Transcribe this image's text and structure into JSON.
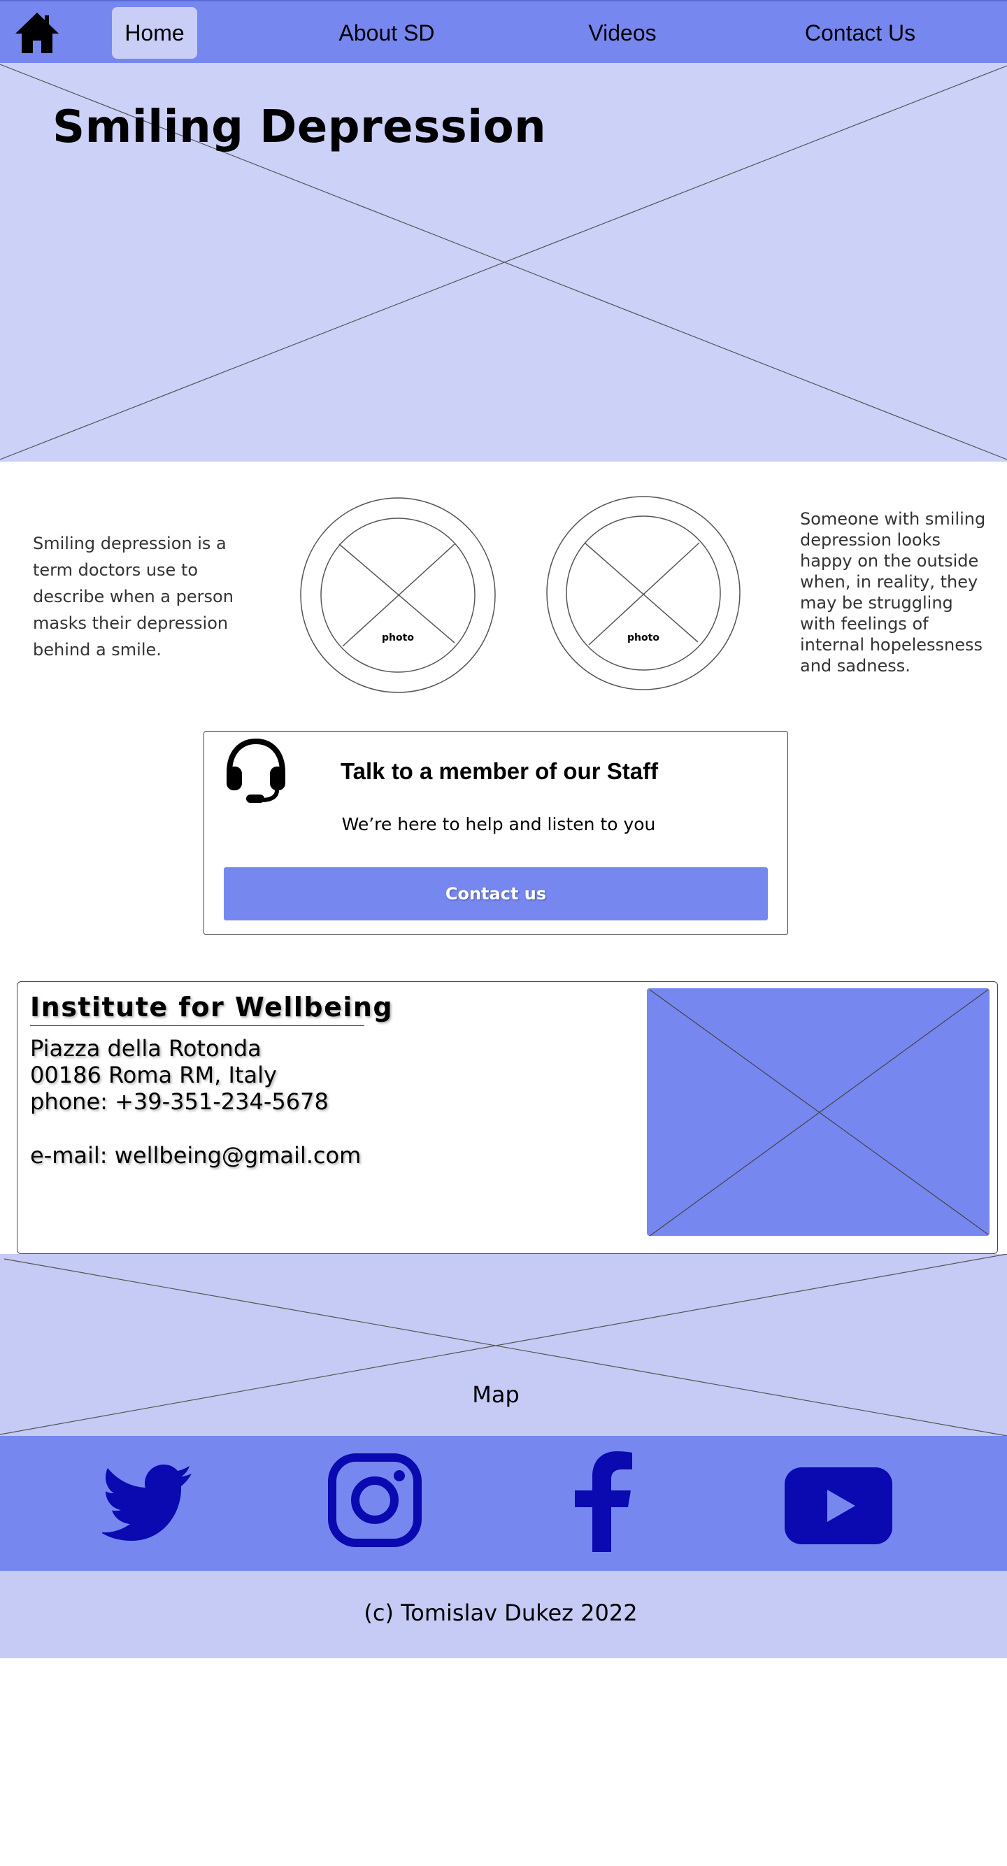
{
  "nav": {
    "items": [
      {
        "label": "Home"
      },
      {
        "label": "About SD"
      },
      {
        "label": "Videos"
      },
      {
        "label": "Contact Us"
      }
    ]
  },
  "hero": {
    "title": "Smiling Depression"
  },
  "info": {
    "left_text": "Smiling depression is a term doctors use to describe when a person masks their depression behind a smile.",
    "right_text": "Someone with smiling depression looks happy on the outside when, in reality, they may be struggling with feelings of internal hopelessness and sadness.",
    "photo_label": "photo"
  },
  "staff": {
    "title": "Talk to a member of our Staff",
    "subtitle": "We’re here to help and listen to you",
    "button_label": "Contact us"
  },
  "institute": {
    "title": "Institute for Wellbeing",
    "address_line_1": "Piazza della Rotonda",
    "address_line_2": "00186 Roma RM, Italy",
    "phone": "phone: +39-351-234-5678",
    "email": "e-mail: wellbeing@gmail.com"
  },
  "map": {
    "label": "Map"
  },
  "social": {
    "icons": [
      "twitter-icon",
      "instagram-icon",
      "facebook-icon",
      "youtube-icon"
    ]
  },
  "footer": {
    "copyright": "(c) Tomislav Dukez 2022"
  },
  "colors": {
    "nav_bg": "#7787f0",
    "hero_bg": "#cbd1f7",
    "section_bg": "#c5cbf4",
    "social_icon": "#0a0ab0",
    "button_bg": "#7787f0"
  }
}
